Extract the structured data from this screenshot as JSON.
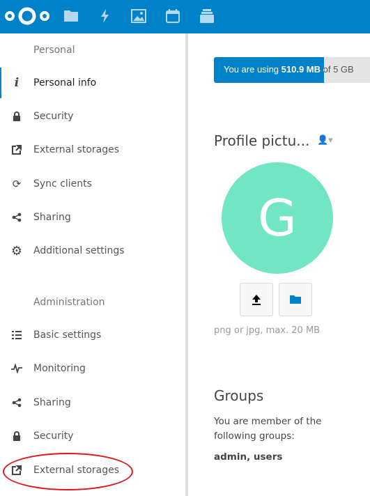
{
  "header": {
    "apps": [
      "files-icon",
      "activity-icon",
      "gallery-icon",
      "calendar-icon",
      "deck-icon"
    ],
    "brand_color": "#0082c9"
  },
  "sidebar": {
    "personal_caption": "Personal",
    "personal": [
      {
        "label": "Personal info",
        "icon": "info-icon",
        "active": true
      },
      {
        "label": "Security",
        "icon": "lock-icon"
      },
      {
        "label": "External storages",
        "icon": "external-link-icon"
      },
      {
        "label": "Sync clients",
        "icon": "sync-icon"
      },
      {
        "label": "Sharing",
        "icon": "share-icon"
      },
      {
        "label": "Additional settings",
        "icon": "gear-icon"
      }
    ],
    "admin_caption": "Administration",
    "admin": [
      {
        "label": "Basic settings",
        "icon": "list-icon"
      },
      {
        "label": "Monitoring",
        "icon": "pulse-icon"
      },
      {
        "label": "Sharing",
        "icon": "share-icon"
      },
      {
        "label": "Security",
        "icon": "lock-icon"
      },
      {
        "label": "External storages",
        "icon": "external-link-icon",
        "highlighted": true
      }
    ]
  },
  "main": {
    "quota": {
      "prefix": "You are using ",
      "used": "510.9 MB",
      "suffix": " of 5 GB",
      "percent": 10
    },
    "profile_title": "Profile pictu...",
    "avatar_letter": "G",
    "avatar_color": "#72e5c4",
    "hint": "png or jpg, max. 20 MB",
    "groups_title": "Groups",
    "groups_text": "You are member of the following groups:",
    "groups": "admin, users"
  }
}
